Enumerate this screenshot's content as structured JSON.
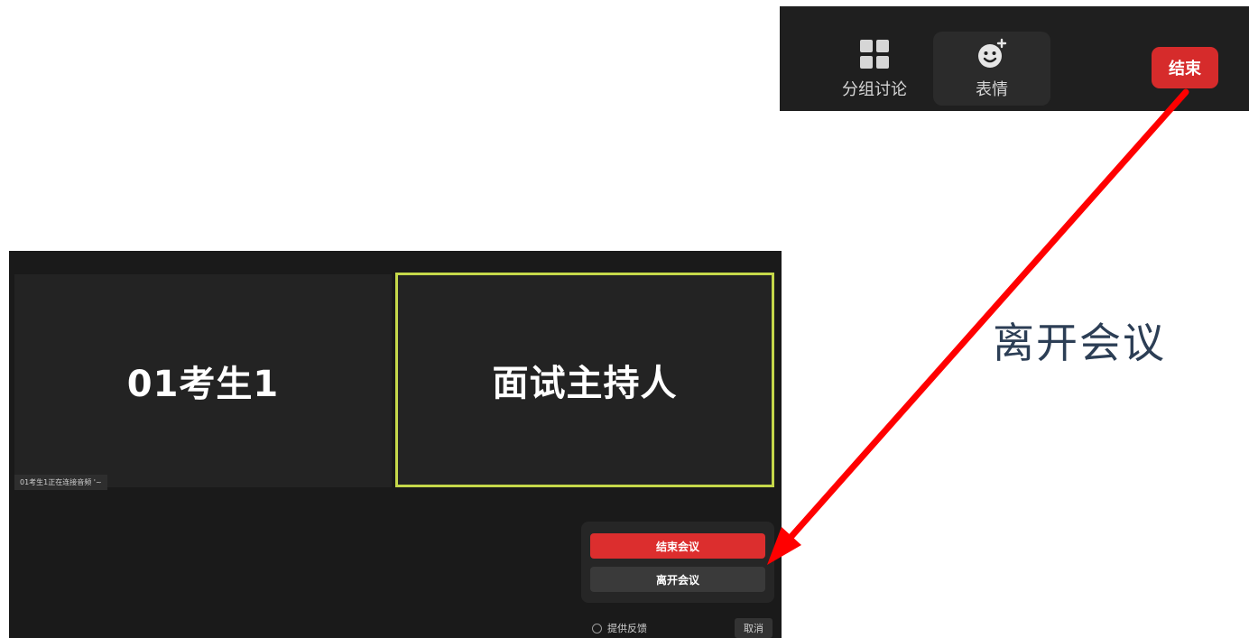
{
  "toolbar": {
    "breakout_label": "分组讨论",
    "breakout_icon": "grid-icon",
    "reactions_label": "表情",
    "reactions_icon": "emoji-add-icon",
    "end_label": "结束"
  },
  "caption": "离开会议",
  "meeting": {
    "student_tile": "01考生1",
    "host_tile": "面试主持人",
    "status_text": "01考生1正在连接音频 '~",
    "end_meeting_label": "结束会议",
    "leave_meeting_label": "离开会议",
    "feedback_label": "提供反馈",
    "cancel_label": "取消"
  },
  "colors": {
    "accent_red": "#d62b2b",
    "arrow_red": "#ff0000",
    "active_speaker_border": "#c5d84a"
  }
}
